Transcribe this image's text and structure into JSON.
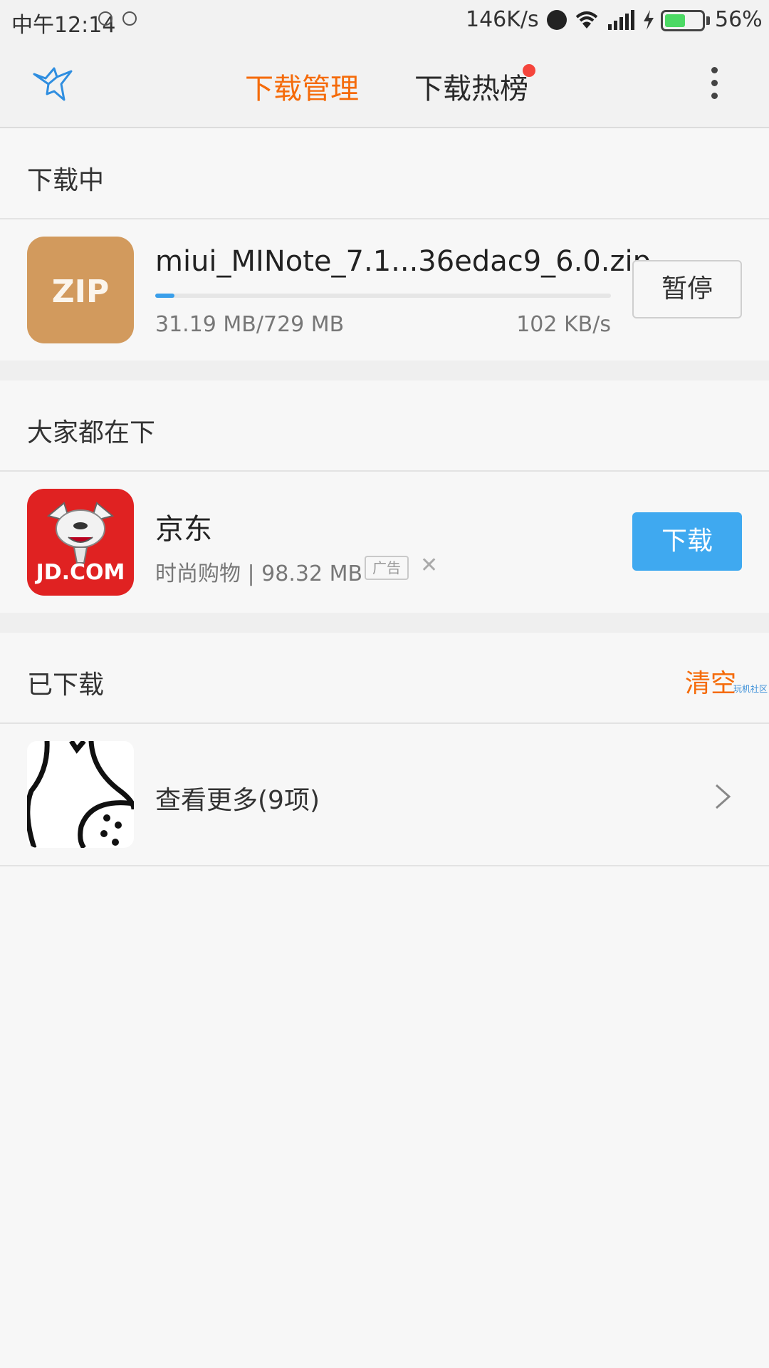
{
  "status_bar": {
    "time": "中午12:14",
    "net_speed": "146K/s",
    "battery_level": 0.56,
    "battery_percent": "56%",
    "icons": [
      "alarm-icon",
      "wifi-icon",
      "signal-icon",
      "charging-icon",
      "battery-icon"
    ]
  },
  "toolbar": {
    "logo_icon": "bird-icon",
    "tabs": [
      {
        "label": "下载管理",
        "active": true
      },
      {
        "label": "下载热榜",
        "active": false,
        "has_badge": true
      }
    ],
    "more_icon": "more-vertical-icon"
  },
  "downloading": {
    "title": "下载中",
    "item": {
      "icon_label": "ZIP",
      "file_name": "miui_MINote_7.1...36edac9_6.0.zip",
      "progress": 0.0428,
      "size": "31.19 MB/729 MB",
      "speed": "102 KB/s",
      "action": "暂停"
    }
  },
  "popular": {
    "title": "大家都在下",
    "item": {
      "icon_label": "JD.COM",
      "name": "京东",
      "meta": "时尚购物 | 98.32 MB",
      "ad_label": "广告",
      "close_symbol": "✕",
      "action": "下载"
    }
  },
  "downloaded": {
    "title": "已下载",
    "clear_label": "清空",
    "watermark": "玩机社区",
    "more_label": "查看更多(9项)"
  },
  "colors": {
    "accent_orange": "#f56b0a",
    "download_blue": "#3fa9f0",
    "progress_blue": "#3a9fea",
    "zip_tan": "#d29a5d",
    "jd_red": "#e02222"
  }
}
